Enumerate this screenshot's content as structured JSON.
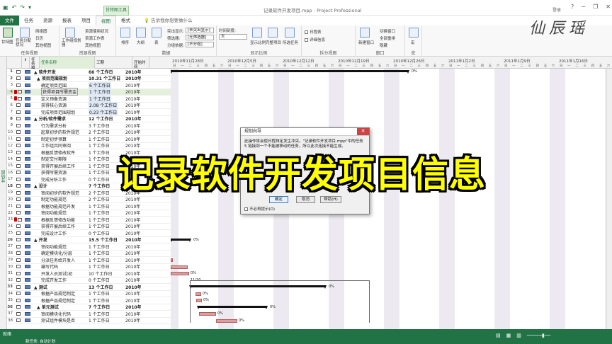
{
  "title_bar": {
    "window_title": "记录软件开发项目.mpp - Project Professional",
    "context_tab_group": "甘特图工具",
    "login": "登录",
    "quick_access": [
      "save-icon",
      "undo-icon",
      "redo-icon",
      "customize-icon"
    ],
    "window_buttons": [
      "?",
      "─",
      "❐",
      "✕"
    ]
  },
  "ribbon_tabs": [
    "文件",
    "任务",
    "资源",
    "报表",
    "项目",
    "视图",
    "格式"
  ],
  "active_tab": "视图",
  "tell_me": "告诉我你想要做什么",
  "ribbon": {
    "task_views": {
      "label": "任务视图",
      "gantt_label": "甘特图",
      "task_usage": "任务分配状况",
      "network": "网络图",
      "calendar": "日历",
      "other": "其他视图"
    },
    "resource_views": {
      "label": "资源视图",
      "team_planner": "工作组规划器",
      "resource_usage": "资源使用状况",
      "resource_sheet": "资源工作表",
      "other": "其他视图"
    },
    "data": {
      "label": "数据",
      "sort": "排序",
      "outline": "大纲",
      "tables": "表",
      "highlight": "[未突出显示]",
      "filter": "[无筛选器]",
      "group": "[不分组]",
      "highlight_label": "突出显示:",
      "filter_label": "筛选器:",
      "group_label": "分组依据:"
    },
    "zoom": {
      "label": "显示比例",
      "timescale_label": "时间刻度:",
      "timescale_value": "天",
      "zoom": "显示比例",
      "entire_project": "完整项目",
      "selected_tasks": "所选任务"
    },
    "split_view": {
      "label": "拆分视图",
      "timeline": "日程表",
      "details": "详细信息"
    },
    "window": {
      "label": "窗口",
      "new_window": "新建窗口",
      "switch": "切换窗口",
      "arrange": "全部重排",
      "hide": "隐藏"
    },
    "macro": {
      "label": "宏",
      "macro": "宏"
    }
  },
  "grid": {
    "headers": {
      "info": "i",
      "mode": "任务模式",
      "name": "任务名称",
      "duration": "工期",
      "start": "开始时间"
    },
    "rows": [
      {
        "id": "1",
        "name": "▲ 软件开发",
        "duration": "66 个工作日",
        "start": "2010年",
        "sum": true
      },
      {
        "id": "2",
        "name": "▲ 项目范围规划",
        "duration": "10.31 个工作日",
        "start": "2010年",
        "sum": true
      },
      {
        "id": "3",
        "name": "确定项目范围",
        "duration": "6 个工作日",
        "start": "2010年"
      },
      {
        "id": "4",
        "name": "获得项目所需资金",
        "duration": "1 个工作日",
        "start": "2010年",
        "sel": true,
        "warn": true
      },
      {
        "id": "5",
        "name": "定义预备资源",
        "duration": "1 个工作日",
        "start": "2010年",
        "warn": true
      },
      {
        "id": "6",
        "name": "获得核心资源",
        "duration": "2.08 个工作日",
        "start": "2010年"
      },
      {
        "id": "7",
        "name": "完成项目范围规划",
        "duration": "0.23 个工作日",
        "start": "2010年"
      },
      {
        "id": "8",
        "name": "▲ 分析/软件需求",
        "duration": "12 个工作日",
        "start": "2010年",
        "sum": true
      },
      {
        "id": "9",
        "name": "行为需求分析",
        "duration": "3 个工作日",
        "start": "2010年"
      },
      {
        "id": "10",
        "name": "起草初步的软件规范",
        "duration": "2 个工作日",
        "start": "2010年"
      },
      {
        "id": "11",
        "name": "制定初步预算",
        "duration": "1 个工作日",
        "start": "2010年"
      },
      {
        "id": "12",
        "name": "工作组共同审阅",
        "duration": "1 个工作日",
        "start": "2010年"
      },
      {
        "id": "13",
        "name": "根据反馈修改软件",
        "duration": "1 个工作日",
        "start": "2010年"
      },
      {
        "id": "14",
        "name": "制定交付期限",
        "duration": "1 个工作日",
        "start": "2010年"
      },
      {
        "id": "15",
        "name": "获得开展后续工作",
        "duration": "1 个工作日",
        "start": "2010年"
      },
      {
        "id": "16",
        "name": "获得所需资源",
        "duration": "1 个工作日",
        "start": "2010年"
      },
      {
        "id": "17",
        "name": "完成分析工作",
        "duration": "0 个工作日",
        "start": "2010年"
      },
      {
        "id": "18",
        "name": "▲ 设计",
        "duration": "7 个工作日",
        "start": "2010年",
        "sum": true
      },
      {
        "id": "19",
        "name": "审阅初步的软件规范",
        "duration": "2 个工作日",
        "start": "2010年"
      },
      {
        "id": "20",
        "name": "制定功能规范",
        "duration": "2 个工作日",
        "start": "2010年"
      },
      {
        "id": "21",
        "name": "根据功能规范开发",
        "duration": "1 个工作日",
        "start": "2010年"
      },
      {
        "id": "22",
        "name": "审阅功能规范",
        "duration": "1 个工作日",
        "start": "2010年"
      },
      {
        "id": "23",
        "name": "根据反馈修改功能",
        "duration": "1 个工作日",
        "start": "2010年",
        "warn": true
      },
      {
        "id": "24",
        "name": "获得开展后续工作",
        "duration": "1 个工作日",
        "start": "2010年"
      },
      {
        "id": "25",
        "name": "完成设计工作",
        "duration": "0 个工作日",
        "start": "2010年"
      },
      {
        "id": "26",
        "name": "▲ 开发",
        "duration": "15.5 个工作日",
        "start": "2010年",
        "sum": true
      },
      {
        "id": "27",
        "name": "审阅功能规范",
        "duration": "1 个工作日",
        "start": "2010年"
      },
      {
        "id": "28",
        "name": "确定模块化/分层",
        "duration": "1 个工作日",
        "start": "2010年"
      },
      {
        "id": "29",
        "name": "分派任务给开发人",
        "duration": "1 个工作日",
        "start": "2010年"
      },
      {
        "id": "30",
        "name": "编写代码",
        "duration": "1 个工作日",
        "start": "2010年"
      },
      {
        "id": "31",
        "name": "开发人员测试(初",
        "duration": "10 个工作日",
        "start": "2010年"
      },
      {
        "id": "32",
        "name": "完成开发工作",
        "duration": "0 个工作日",
        "start": "2010年"
      },
      {
        "id": "33",
        "name": "▲ 测试",
        "duration": "13 个工作日",
        "start": "2010年",
        "sum": true
      },
      {
        "id": "34",
        "name": "根据产品规范制定",
        "duration": "1 个工作日",
        "start": "2010年"
      },
      {
        "id": "35",
        "name": "根据产品规范制定",
        "duration": "1 个工作日",
        "start": "2010年"
      },
      {
        "id": "36",
        "name": "▲ 单元测试",
        "duration": "7 个工作日",
        "start": "2010年",
        "sum": true
      },
      {
        "id": "37",
        "name": "审阅模块化代码",
        "duration": "1 个工作日",
        "start": "2010年"
      },
      {
        "id": "38",
        "name": "测试组件模块是否",
        "duration": "1 个工作日",
        "start": "2010年"
      }
    ]
  },
  "timescale": {
    "weeks": [
      "2010年11月28日",
      "2010年12月5日",
      "2010年12月12日",
      "2010年12月19日",
      "2010年12月26日",
      "2011年1月2日",
      "2011年1月9日",
      "2011年1月16日"
    ],
    "days": [
      "日",
      "一",
      "二",
      "三",
      "四",
      "五",
      "六"
    ]
  },
  "chart": {
    "pct_zero": "0%",
    "milestone_date": "11/30"
  },
  "side_label": "甘特图",
  "status": {
    "ready": "就绪",
    "new_tasks": "新任务: 自动计划"
  },
  "dialog": {
    "title": "规划向导",
    "message": "此操作将会使日程排定发生冲突。\"记录软件开发项目.mpp\"中的任务 5 链接到一个不能被移动的任务，所以此次连接不能生成。",
    "ok": "确定",
    "cancel": "取消",
    "help": "帮助(H)",
    "dont_show": "不必再提示(D)"
  },
  "overlay_caption": "记录软件开发项目信息",
  "watermark": "仙辰瑶",
  "colors": {
    "accent": "#217346",
    "caption": "#ffff00",
    "critical": "#d9a0a0"
  }
}
